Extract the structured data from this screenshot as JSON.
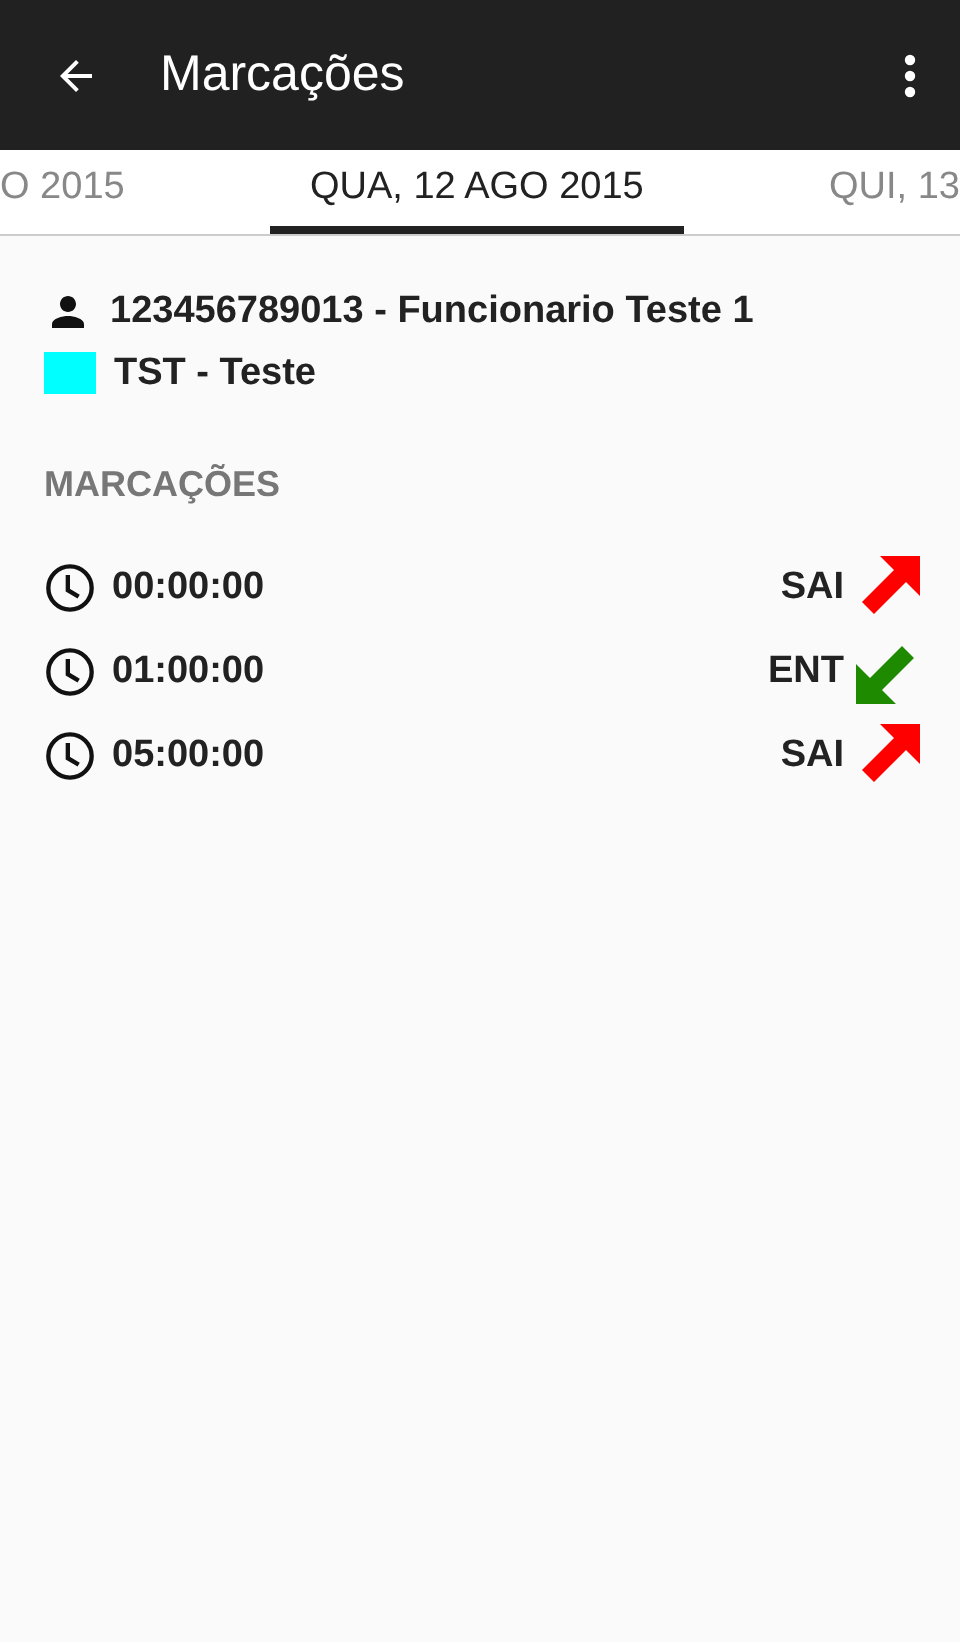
{
  "app_bar": {
    "title": "Marcações"
  },
  "tabs": [
    {
      "label": "O 2015",
      "selected": false
    },
    {
      "label": "QUA, 12 AGO 2015",
      "selected": true
    },
    {
      "label": "QUI, 13",
      "selected": false
    }
  ],
  "employee": {
    "name": "123456789013 - Funcionario Teste 1",
    "department": "TST - Teste",
    "color": "#00ffff"
  },
  "section_title": "MARCAÇÕES",
  "punches": [
    {
      "time": "00:00:00",
      "type": "SAI",
      "kind": "out"
    },
    {
      "time": "01:00:00",
      "type": "ENT",
      "kind": "in"
    },
    {
      "time": "05:00:00",
      "type": "SAI",
      "kind": "out"
    }
  ]
}
